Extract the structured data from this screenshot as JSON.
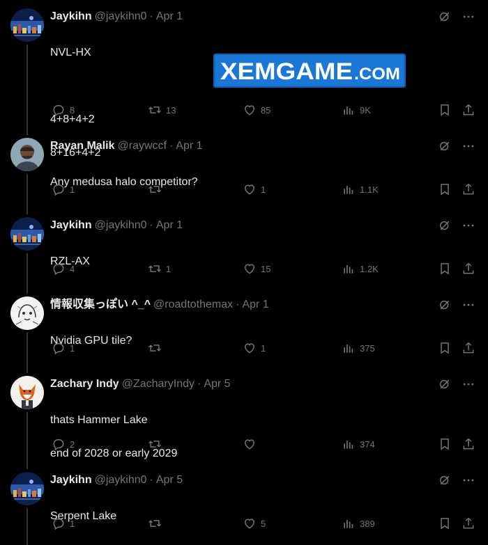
{
  "colors": {
    "background": "#000000",
    "muted": "#71767b",
    "text": "#e7e9ea",
    "watermark": "#1a78d4"
  },
  "watermark": {
    "text": "XEMGAME.COM"
  },
  "tweets": [
    {
      "name": "Jaykihn",
      "handle": "@jaykihn0",
      "date": "Apr 1",
      "lines": [
        "NVL-HX",
        "",
        "4+8+4+2",
        "8+16+4+2"
      ],
      "replies": "8",
      "retweets": "13",
      "likes": "85",
      "views": "9K",
      "avatar": "city-night"
    },
    {
      "name": "Rayan Malik",
      "handle": "@raywccf",
      "date": "Apr 1",
      "lines": [
        "Any medusa halo competitor?"
      ],
      "replies": "1",
      "retweets": "",
      "likes": "1",
      "views": "1.1K",
      "avatar": "person"
    },
    {
      "name": "Jaykihn",
      "handle": "@jaykihn0",
      "date": "Apr 1",
      "lines": [
        "RZL-AX"
      ],
      "replies": "4",
      "retweets": "1",
      "likes": "15",
      "views": "1.2K",
      "avatar": "city-night"
    },
    {
      "name": "情報収集っぽい ^_^",
      "handle": "@roadtothemax",
      "date": "Apr 1",
      "lines": [
        "Nvidia GPU tile?"
      ],
      "replies": "1",
      "retweets": "",
      "likes": "1",
      "views": "375",
      "avatar": "sketch"
    },
    {
      "name": "Zachary Indy",
      "handle": "@ZacharyIndy",
      "date": "Apr 5",
      "lines": [
        "thats Hammer Lake",
        "end of 2028 or early 2029"
      ],
      "replies": "2",
      "retweets": "",
      "likes": "",
      "views": "374",
      "avatar": "fox"
    },
    {
      "name": "Jaykihn",
      "handle": "@jaykihn0",
      "date": "Apr 5",
      "lines": [
        "Serpent Lake"
      ],
      "replies": "1",
      "retweets": "",
      "likes": "5",
      "views": "389",
      "avatar": "city-night"
    }
  ]
}
